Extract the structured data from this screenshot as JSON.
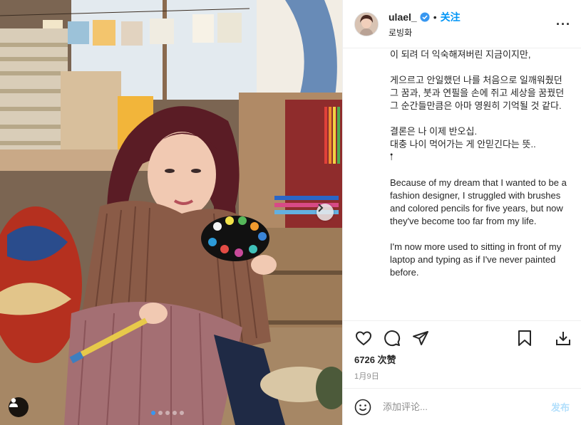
{
  "post": {
    "username": "ulael_",
    "verified": true,
    "separator": "•",
    "follow_label": "关注",
    "location": "로빙화",
    "more_label": "···"
  },
  "caption": [
    "이 되려 더 익숙해져버린 지금이지만,",
    "게으르고 안일했던 나를 처음으로 일깨워줬던 그 꿈과, 붓과 연필을 손에 쥐고 세상을 꿈꿨던 그 순간들만큼은 아마 영원히 기억될 것 같다.",
    "결론은 나 이제 반오십.\n대충 나이 먹어가는 게 안믿긴다는 뜻..\n𖡡",
    "Because of my dream that I wanted to be a fashion designer, I struggled with brushes and colored pencils for five years, but now they've become too far from my life.",
    "I'm now more used to sitting in front of my laptop and typing as if I've never painted before."
  ],
  "likes": "6726 次赞",
  "date": "1月9日",
  "comment": {
    "placeholder": "添加评论...",
    "post_label": "发布"
  },
  "carousel": {
    "slide_count": 5,
    "active_index": 0
  },
  "colors": {
    "accent": "#0095f6",
    "post_disabled": "#b2dffc",
    "active_dot": "#3897f0"
  },
  "icons": [
    "heart-icon",
    "comment-icon",
    "share-icon",
    "bookmark-icon",
    "download-icon",
    "emoji-icon",
    "verified-icon",
    "user-tag-icon",
    "chevron-right-icon"
  ]
}
